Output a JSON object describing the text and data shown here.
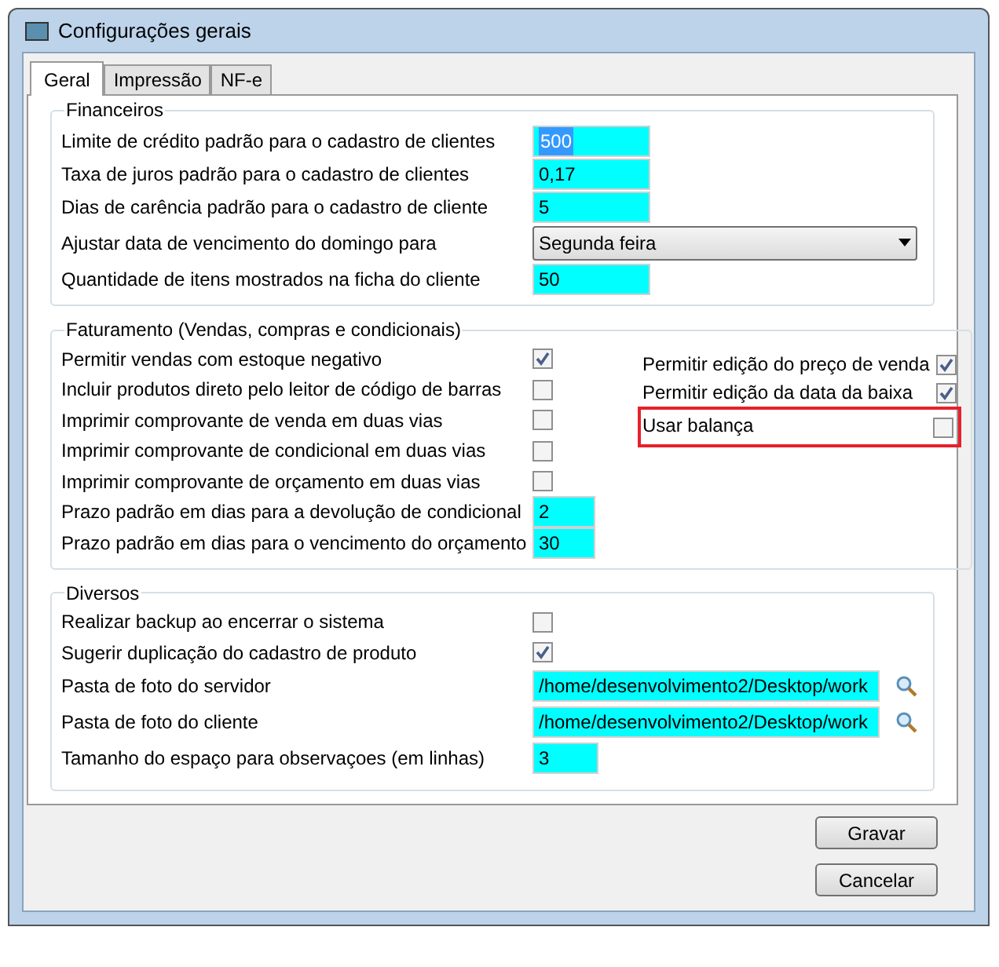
{
  "window": {
    "title": "Configurações gerais"
  },
  "tabs": [
    {
      "label": "Geral",
      "selected": true
    },
    {
      "label": "Impressão",
      "selected": false
    },
    {
      "label": "NF-e",
      "selected": false
    }
  ],
  "financeiros": {
    "title": "Financeiros",
    "rows": [
      {
        "kind": "input",
        "label": "Limite de crédito padrão para o cadastro de clientes",
        "value": "500",
        "focused": true
      },
      {
        "kind": "input",
        "label": "Taxa de juros padrão para o cadastro de clientes",
        "value": "0,17",
        "focused": false
      },
      {
        "kind": "input",
        "label": "Dias de carência padrão para o cadastro de cliente",
        "value": "5",
        "focused": false
      },
      {
        "kind": "select",
        "label": "Ajustar data de vencimento do domingo para",
        "value": "Segunda feira"
      },
      {
        "kind": "input",
        "label": "Quantidade de itens mostrados na ficha do cliente",
        "value": "50",
        "focused": false
      }
    ]
  },
  "faturamento": {
    "title": "Faturamento (Vendas, compras e condicionais)",
    "left": [
      {
        "kind": "checkbox",
        "label": "Permitir vendas com estoque negativo",
        "checked": true
      },
      {
        "kind": "checkbox",
        "label": "Incluir produtos direto pelo leitor de código de barras",
        "checked": false
      },
      {
        "kind": "checkbox",
        "label": "Imprimir comprovante de venda em duas vias",
        "checked": false
      },
      {
        "kind": "checkbox",
        "label": "Imprimir comprovante de condicional em duas vias",
        "checked": false
      },
      {
        "kind": "checkbox",
        "label": "Imprimir comprovante de orçamento em duas vias",
        "checked": false
      },
      {
        "kind": "input",
        "label": "Prazo padrão em dias para a devolução de condicional",
        "value": "2"
      },
      {
        "kind": "input",
        "label": "Prazo padrão em dias para o vencimento do orçamento",
        "value": "30"
      }
    ],
    "right": [
      {
        "label": "Permitir edição do preço de venda",
        "checked": true,
        "highlighted": false
      },
      {
        "label": "Permitir edição da data da baixa",
        "checked": true,
        "highlighted": false
      },
      {
        "label": "Usar balança",
        "checked": false,
        "highlighted": true
      }
    ]
  },
  "diversos": {
    "title": "Diversos",
    "rows": [
      {
        "kind": "checkbox",
        "label": "Realizar backup ao encerrar o sistema",
        "checked": false
      },
      {
        "kind": "checkbox",
        "label": "Sugerir duplicação do cadastro de produto",
        "checked": true
      },
      {
        "kind": "path",
        "label": "Pasta de foto do servidor",
        "value": "/home/desenvolvimento2/Desktop/work"
      },
      {
        "kind": "path",
        "label": "Pasta de foto do cliente",
        "value": "/home/desenvolvimento2/Desktop/work"
      },
      {
        "kind": "input",
        "label": "Tamanho do espaço para observaçoes (em linhas)",
        "value": "3"
      }
    ]
  },
  "buttons": [
    {
      "label": "Gravar"
    },
    {
      "label": "Cancelar"
    }
  ]
}
